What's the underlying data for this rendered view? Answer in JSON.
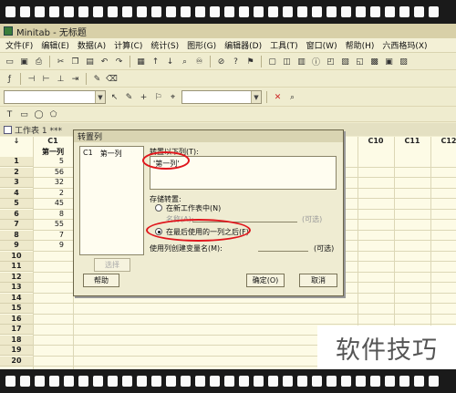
{
  "window": {
    "title": "Minitab - 无标题"
  },
  "menu": [
    "文件(F)",
    "编辑(E)",
    "数据(A)",
    "计算(C)",
    "统计(S)",
    "图形(G)",
    "编辑器(D)",
    "工具(T)",
    "窗口(W)",
    "帮助(H)",
    "六西格玛(X)"
  ],
  "worksheet": {
    "title": "工作表 1 ***",
    "columns_left": [
      "C1"
    ],
    "columns_right": [
      "C10",
      "C11",
      "C12"
    ],
    "column_name": "第一列",
    "row_marker": "↓",
    "rows": [
      "1",
      "2",
      "3",
      "4",
      "5",
      "6",
      "7",
      "8",
      "9",
      "10",
      "11",
      "12",
      "13",
      "14",
      "15",
      "16",
      "17",
      "18",
      "19",
      "20"
    ],
    "values": [
      "5",
      "56",
      "32",
      "2",
      "45",
      "8",
      "55",
      "7",
      "9"
    ]
  },
  "dialog": {
    "title": "转置列",
    "var_list": [
      {
        "col": "C1",
        "name": "第一列"
      }
    ],
    "transpose_label": "转置以下列(T):",
    "transpose_value": "'第一列'",
    "store_label": "存储转置:",
    "opt_new_worksheet": "在新工作表中(N)",
    "opt_name_label": "名称(A):",
    "optional_1": "(可选)",
    "opt_after_last": "在最后使用的一列之后(F)",
    "var_name_label": "使用列创建变量名(M):",
    "optional_2": "(可选)",
    "select_button": "选择",
    "help_button": "帮助",
    "ok_button": "确定(O)",
    "cancel_button": "取消"
  },
  "watermark": "软件技巧",
  "highlight_color": "#e0161c"
}
